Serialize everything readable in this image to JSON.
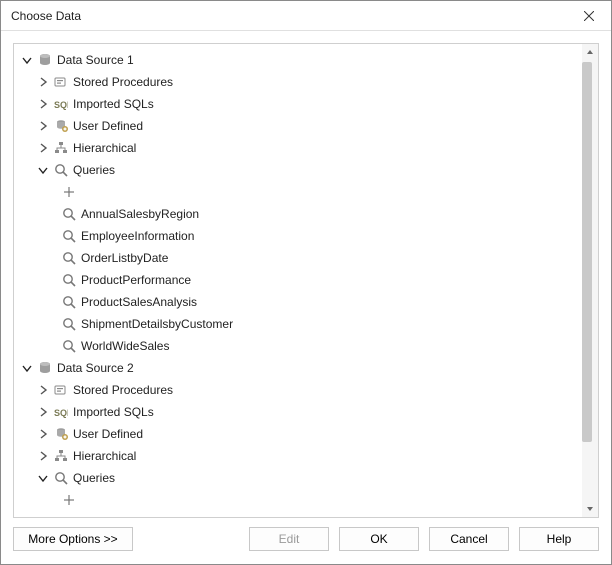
{
  "window": {
    "title": "Choose Data"
  },
  "tree": {
    "newQuery": "<New Query…>",
    "dataSources": [
      {
        "name": "Data Source 1",
        "expanded": true,
        "children": [
          {
            "kind": "stored-procedures",
            "label": "Stored Procedures",
            "expanded": false
          },
          {
            "kind": "imported-sqls",
            "label": "Imported SQLs",
            "expanded": false
          },
          {
            "kind": "user-defined",
            "label": "User Defined",
            "expanded": false
          },
          {
            "kind": "hierarchical",
            "label": "Hierarchical",
            "expanded": false
          },
          {
            "kind": "queries",
            "label": "Queries",
            "expanded": true,
            "queries": [
              "AnnualSalesbyRegion",
              "EmployeeInformation",
              "OrderListbyDate",
              "ProductPerformance",
              "ProductSalesAnalysis",
              "ShipmentDetailsbyCustomer",
              "WorldWideSales"
            ]
          }
        ]
      },
      {
        "name": "Data Source 2",
        "expanded": true,
        "children": [
          {
            "kind": "stored-procedures",
            "label": "Stored Procedures",
            "expanded": false
          },
          {
            "kind": "imported-sqls",
            "label": "Imported SQLs",
            "expanded": false
          },
          {
            "kind": "user-defined",
            "label": "User Defined",
            "expanded": false
          },
          {
            "kind": "hierarchical",
            "label": "Hierarchical",
            "expanded": false
          },
          {
            "kind": "queries",
            "label": "Queries",
            "expanded": true,
            "queries": []
          }
        ]
      }
    ]
  },
  "buttons": {
    "moreOptions": "More Options >>",
    "edit": "Edit",
    "ok": "OK",
    "cancel": "Cancel",
    "help": "Help"
  }
}
